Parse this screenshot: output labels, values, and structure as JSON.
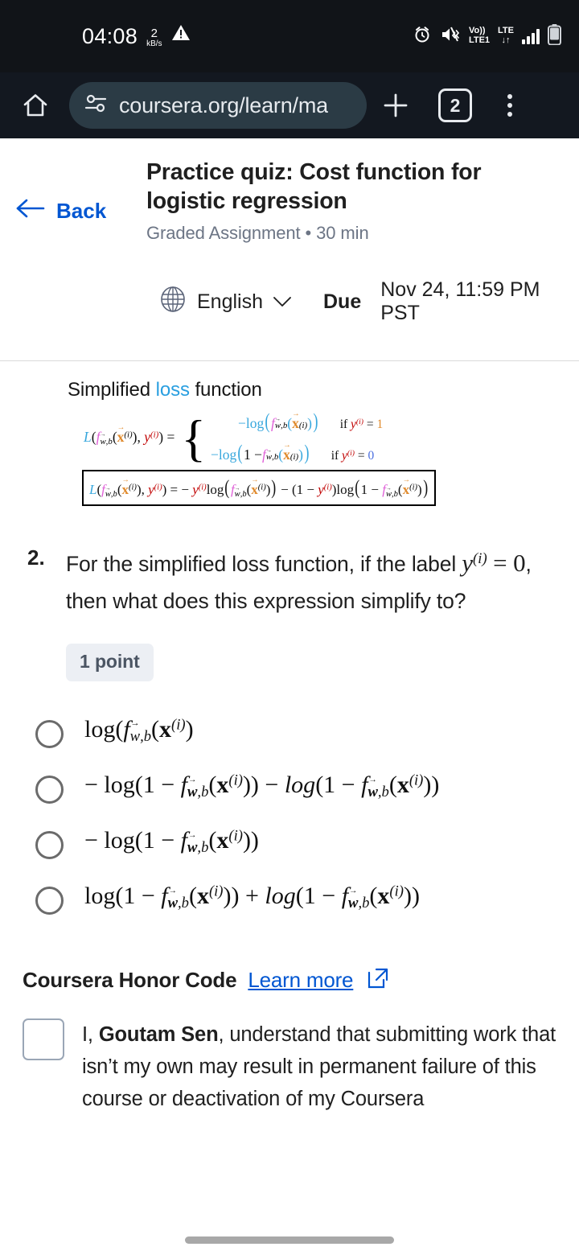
{
  "status_bar": {
    "time": "04:08",
    "data_rate_value": "2",
    "data_rate_unit": "kB/s",
    "warning_icon": "warning-triangle-icon",
    "alarm_icon": "alarm-clock-icon",
    "mute_icon": "vibrate-mute-icon",
    "volte_line1": "Vo))",
    "volte_line2": "LTE1",
    "lte_line1": "LTE",
    "lte_line2": "↓↑",
    "signal_icon": "signal-bars-icon",
    "battery_icon": "battery-icon"
  },
  "browser": {
    "home_icon": "home-icon",
    "site_settings_icon": "site-settings-icon",
    "url": "coursera.org/learn/ma",
    "new_tab_icon": "plus-icon",
    "tab_count": "2",
    "menu_icon": "overflow-menu-icon"
  },
  "quiz_header": {
    "back_icon": "back-arrow-icon",
    "back_label": "Back",
    "title": "Practice quiz: Cost function for logistic regression",
    "subtitle": "Graded Assignment • 30 min",
    "globe_icon": "globe-icon",
    "language": "English",
    "chevron_icon": "chevron-down-icon",
    "due_label": "Due",
    "due_value": "Nov 24, 11:59 PM PST"
  },
  "slide": {
    "caption_pre": "Simplified ",
    "caption_highlight": "loss",
    "caption_post": " function",
    "piecewise_lhs": "L(f_w,b(x^(i)), y^(i)) =",
    "case_1": "−log(f_w,b(x^(i)))",
    "case_1_condition": "if y^(i) = 1",
    "case_2": "−log(1 − f_w,b(x^(i)))",
    "case_2_condition": "if y^(i) = 0",
    "boxed_formula": "L(f_w,b(x^(i)), y^(i)) = − y^(i) log(f_w,b(x^(i))) − (1 − y^(i)) log(1 − f_w,b(x^(i)))",
    "colors": {
      "loss_blue": "#2a9fe0",
      "math_cyan": "#37a7dd",
      "math_magenta": "#e060d8",
      "math_red": "#c00000",
      "math_blue": "#4a6ee0",
      "math_orange": "#e08b2e"
    }
  },
  "question": {
    "number": "2.",
    "text_part1": "For the simplified loss function, if the label ",
    "math_inline": "y^(i) = 0",
    "text_part2": ", then what does this expression simplify to?",
    "points_badge": "1 point"
  },
  "options": [
    {
      "id": "option-1",
      "text": "log( f_w,b( x^(i) )",
      "selected": false
    },
    {
      "id": "option-2",
      "text": "− log(1 − f_w,b( x^(i) )) − log(1 − f_w,b( x^(i) ))",
      "selected": false
    },
    {
      "id": "option-3",
      "text": "− log(1 − f_w,b( x^(i) ))",
      "selected": false
    },
    {
      "id": "option-4",
      "text": "log(1 − f_w,b( x^(i) )) + log(1 − f_w,b( x^(i) ))",
      "selected": false
    }
  ],
  "honor_code": {
    "title": "Coursera Honor Code",
    "learn_more": "Learn more",
    "external_icon": "external-link-icon",
    "checkbox_checked": false,
    "statement_prefix": "I, ",
    "user_name": "Goutam Sen",
    "statement_rest": ", understand that submitting work that isn’t my own may result in permanent failure of this course or deactivation of my Coursera"
  }
}
